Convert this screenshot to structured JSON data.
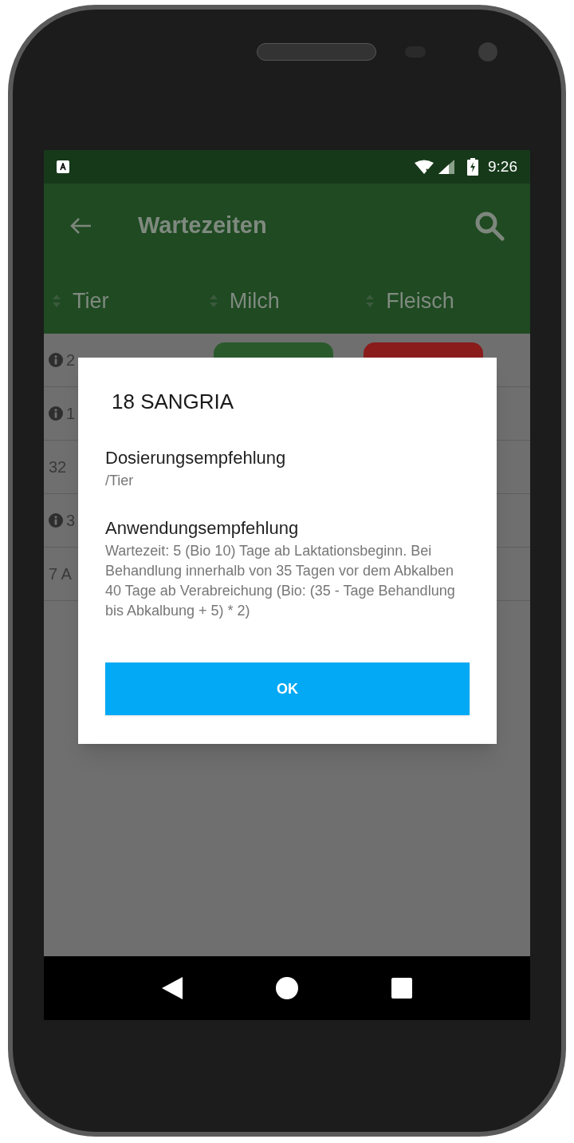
{
  "status_bar": {
    "time": "9:26"
  },
  "app_bar": {
    "title": "Wartezeiten"
  },
  "columns": [
    "Tier",
    "Milch",
    "Fleisch"
  ],
  "rows": [
    {
      "info": true,
      "label": "2",
      "pills": [
        {
          "color": "#2a5a2c"
        },
        {
          "color": "#8a1c1c"
        }
      ]
    },
    {
      "info": true,
      "label": "1",
      "pills": []
    },
    {
      "info": false,
      "label": "32",
      "pills": []
    },
    {
      "info": true,
      "label": "3",
      "pills": []
    },
    {
      "info": false,
      "label": "7 A",
      "pills": []
    }
  ],
  "dialog": {
    "title": "18 SANGRIA",
    "sections": [
      {
        "heading": "Dosierungsempfehlung",
        "text": "/Tier"
      },
      {
        "heading": "Anwendungsempfehlung",
        "text": "Wartezeit: 5 (Bio 10) Tage ab Laktationsbeginn. Bei Behandlung innerhalb von 35 Tagen vor dem Abkalben 40 Tage ab Verabreichung (Bio: (35 - Tage Behandlung bis Abkalbung + 5) * 2)"
      }
    ],
    "button": "OK"
  }
}
